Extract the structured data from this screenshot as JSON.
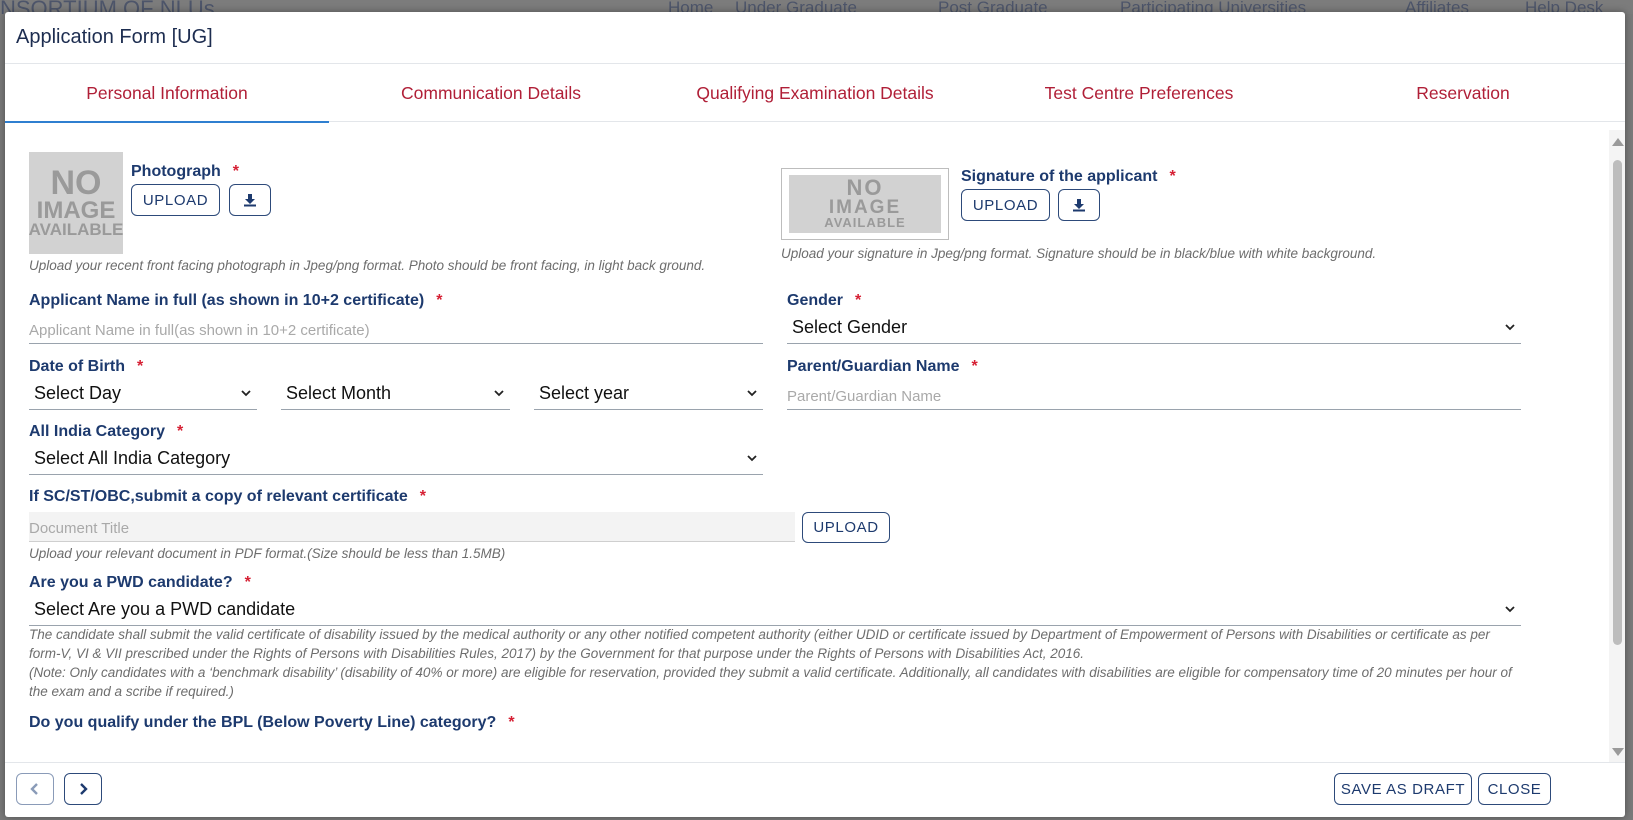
{
  "background": {
    "brand_fragment": "NSORTIUM OF NLUs",
    "nav": [
      "Home",
      "Under Graduate",
      "Post Graduate",
      "Participating Universities",
      "Affiliates",
      "Help Desk"
    ]
  },
  "modal": {
    "title": "Application Form [UG]"
  },
  "tabs": [
    {
      "label": "Personal Information",
      "active": true
    },
    {
      "label": "Communication Details",
      "active": false
    },
    {
      "label": "Qualifying Examination Details",
      "active": false
    },
    {
      "label": "Test Centre Preferences",
      "active": false
    },
    {
      "label": "Reservation",
      "active": false
    }
  ],
  "photo": {
    "label": "Photograph",
    "placeholder_text": [
      "NO",
      "IMAGE",
      "AVAILABLE"
    ],
    "upload_label": "UPLOAD",
    "hint": "Upload your recent front facing photograph in Jpeg/png format. Photo should be front facing, in light back ground."
  },
  "signature": {
    "label": "Signature of the applicant",
    "placeholder_text": [
      "NO",
      "IMAGE",
      "AVAILABLE"
    ],
    "upload_label": "UPLOAD",
    "hint": "Upload your signature in Jpeg/png format. Signature should be in black/blue with white background."
  },
  "applicant_name": {
    "label": "Applicant Name in full (as shown in 10+2 certificate)",
    "placeholder": "Applicant Name in full(as shown in 10+2 certificate)"
  },
  "gender": {
    "label": "Gender",
    "value": "Select Gender"
  },
  "dob": {
    "label": "Date of Birth",
    "day": "Select Day",
    "month": "Select Month",
    "year": "Select year"
  },
  "guardian": {
    "label": "Parent/Guardian Name",
    "placeholder": "Parent/Guardian Name"
  },
  "category": {
    "label": "All India Category",
    "value": "Select All India Category"
  },
  "certificate": {
    "label": "If SC/ST/OBC,submit a copy of relevant certificate",
    "placeholder": "Document Title",
    "upload_label": "UPLOAD",
    "hint": "Upload your relevant document in PDF format.(Size should be less than 1.5MB)"
  },
  "pwd": {
    "label": "Are you a PWD candidate?",
    "value": "Select Are you a PWD candidate",
    "hint1": "The candidate shall submit the valid certificate of disability issued by the medical authority or any other notified competent authority (either UDID or certificate issued by Department of Empowerment of Persons with Disabilities or certificate as per form-V, VI & VII prescribed under the Rights of Persons with Disabilities Rules, 2017) by the Government for that purpose under the Rights of Persons with Disabilities Act, 2016.",
    "hint2": "(Note: Only candidates with a ‘benchmark disability’ (disability of 40% or more) are eligible for reservation, provided they submit a valid certificate. Additionally, all candidates with disabilities are eligible for compensatory time of 20 minutes per hour of the exam and a scribe if required.)"
  },
  "bpl": {
    "label": "Do you qualify under the BPL (Below Poverty Line) category?"
  },
  "footer": {
    "save_draft_label": "SAVE AS DRAFT",
    "close_label": "CLOSE"
  },
  "required_marker": "*",
  "colors": {
    "tab_text": "#b01f37",
    "active_underline": "#2f7fd0",
    "label": "#1d3a6e",
    "required": "#d62034"
  }
}
